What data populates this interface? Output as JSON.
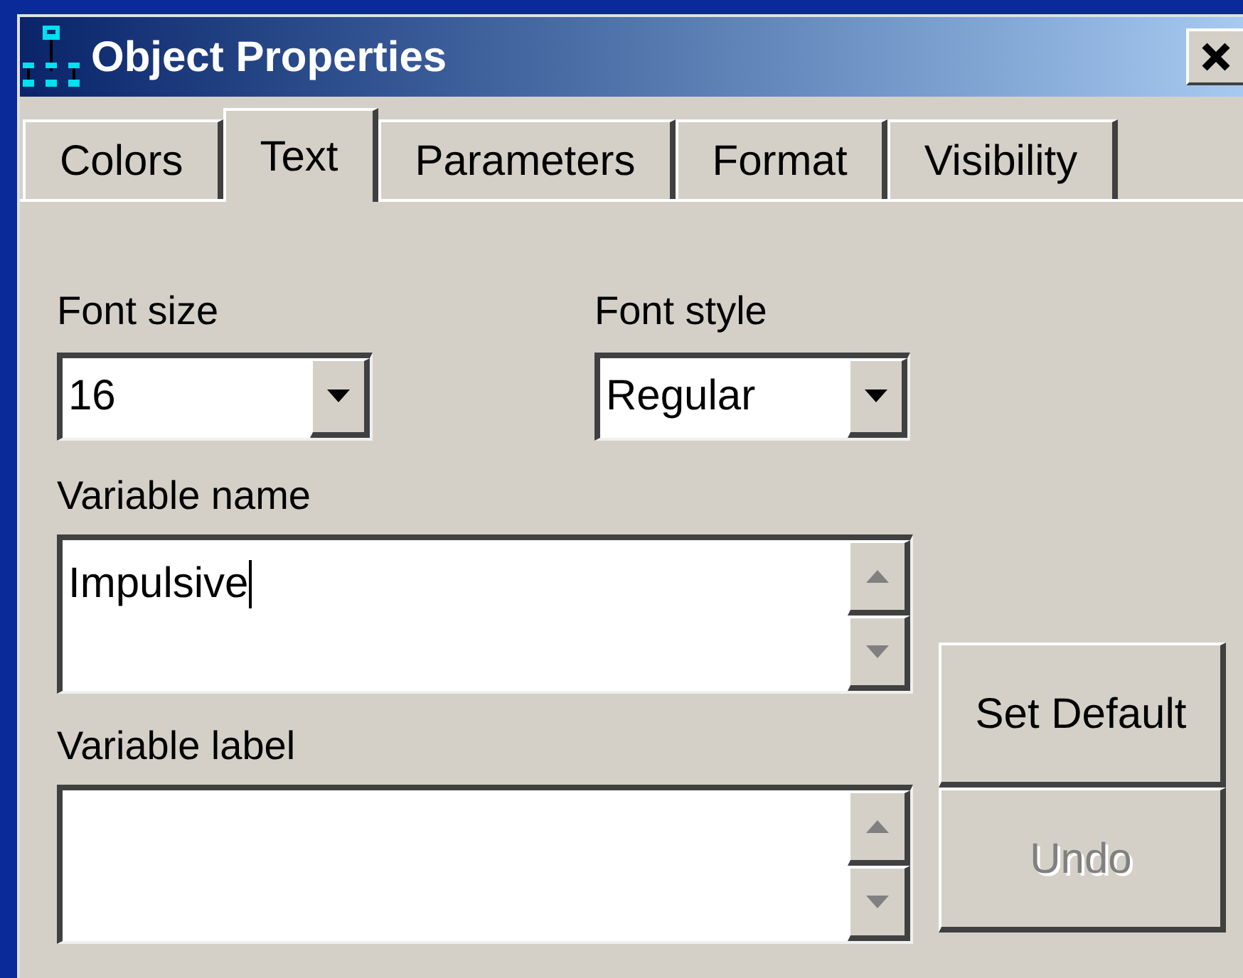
{
  "window": {
    "title": "Object Properties"
  },
  "tabs": [
    {
      "label": "Colors",
      "selected": false
    },
    {
      "label": "Text",
      "selected": true
    },
    {
      "label": "Parameters",
      "selected": false
    },
    {
      "label": "Format",
      "selected": false
    },
    {
      "label": "Visibility",
      "selected": false
    }
  ],
  "font_size": {
    "label": "Font size",
    "value": "16"
  },
  "font_style": {
    "label": "Font style",
    "value": "Regular"
  },
  "variable_name": {
    "label": "Variable name",
    "value": "Impulsive"
  },
  "variable_label": {
    "label": "Variable label"
  },
  "buttons": [
    {
      "label": "Set Default",
      "disabled": false
    },
    {
      "label": "Undo",
      "disabled": true
    }
  ]
}
